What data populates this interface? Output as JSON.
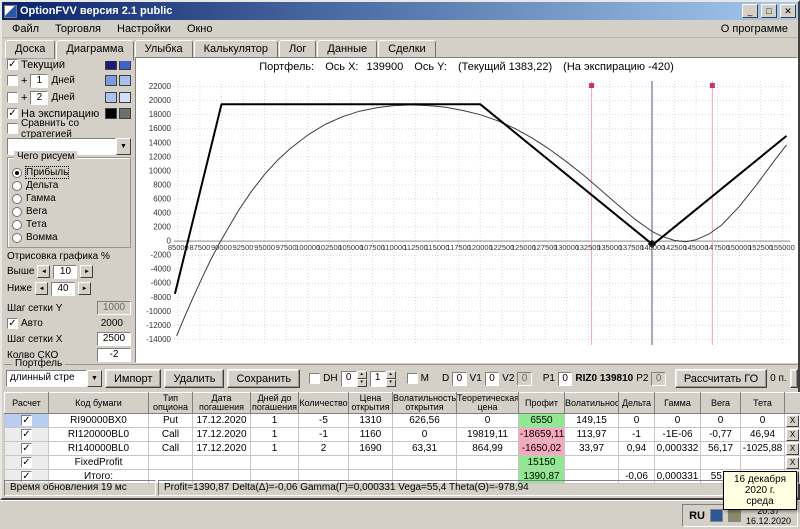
{
  "window": {
    "title": "OptionFVV версия 2.1 public",
    "controls": {
      "minimize": "_",
      "maximize": "□",
      "close": "✕"
    }
  },
  "menu": {
    "items": [
      "Файл",
      "Торговля",
      "Настройки",
      "Окно"
    ],
    "about": "О программе"
  },
  "tabs": {
    "items": [
      "Доска",
      "Диаграмма",
      "Улыбка",
      "Калькулятор",
      "Лог",
      "Данные",
      "Сделки"
    ],
    "active_index": 1
  },
  "sidebar": {
    "current": {
      "label": "Текущий",
      "colors": [
        "#1c1c74",
        "#3f63c8"
      ]
    },
    "day1": {
      "plus": "+",
      "value": "1",
      "label": "Дней",
      "colors": [
        "#7d9ce0",
        "#a8c0ec"
      ]
    },
    "day2": {
      "plus": "+",
      "value": "2",
      "label": "Дней",
      "colors": [
        "#aac2ee",
        "#d3e1f6"
      ]
    },
    "expiration": {
      "label": "На экспирацию",
      "colors": [
        "#000000",
        "#6e6e6e"
      ]
    },
    "compare": {
      "label": "Сравнить со стратегией"
    },
    "strategy_value": "",
    "draw": {
      "title": "Чего рисуем",
      "options": [
        "Прибыль",
        "Дельта",
        "Гамма",
        "Вега",
        "Тета",
        "Вомма"
      ],
      "selected_index": 0
    },
    "render_pct": {
      "label": "Отрисовка графика %",
      "above_label": "Выше",
      "above_value": "10",
      "below_label": "Ниже",
      "below_value": "40"
    },
    "grid": {
      "y_label": "Шаг сетки Y",
      "y_value": "1000",
      "auto_label": "Авто",
      "auto_value": "2000",
      "x_label": "Шаг сетки X",
      "x_value": "2500"
    },
    "sko": {
      "label": "Колво СКО",
      "value": "-2"
    }
  },
  "chart_header": {
    "portfolio": "Портфель:",
    "x_label": "Ось X:",
    "x_value": "139900",
    "y_label": "Ось Y:",
    "current": "(Текущий 1383,22)",
    "expiration": "(На экспирацию -420)"
  },
  "chart_data": {
    "type": "line",
    "title": "Портфель: Ось X: 139900 Ось Y: (Текущий 1383,22) (На экспирацию -420)",
    "xlim": [
      84500,
      155900
    ],
    "ylim": [
      -14800,
      22800
    ],
    "x_ticks": [
      85000,
      87500,
      90000,
      92500,
      95000,
      97500,
      100000,
      102500,
      105000,
      107500,
      110000,
      112500,
      115000,
      117500,
      120000,
      122500,
      125000,
      127500,
      130000,
      132500,
      135000,
      137500,
      140000,
      142500,
      145000,
      147500,
      150000,
      152500,
      155000
    ],
    "y_ticks": [
      22000,
      20000,
      18000,
      16000,
      14000,
      12000,
      10000,
      8000,
      6000,
      4000,
      2000,
      0,
      -2000,
      -4000,
      -6000,
      -8000,
      -10000,
      -12000,
      -14000
    ],
    "grid": true,
    "x_labels_at_zero": true,
    "current_x": 139900,
    "sd_lines": [
      132900,
      146900
    ],
    "sd_color": "#f0a6c0",
    "sd_marker_color": "#cc3366",
    "current_line_color": "#55607a",
    "marker": {
      "x": 139900,
      "y": -420
    },
    "series": [
      {
        "name": "Текущий",
        "color": "#3c3c3c",
        "width": 1,
        "points": [
          [
            84800,
            -13500
          ],
          [
            85800,
            -10600
          ],
          [
            86800,
            -7800
          ],
          [
            87800,
            -5100
          ],
          [
            88800,
            -2550
          ],
          [
            89800,
            -250
          ],
          [
            90800,
            1900
          ],
          [
            92000,
            4400
          ],
          [
            93500,
            7100
          ],
          [
            95000,
            9500
          ],
          [
            96500,
            11500
          ],
          [
            98000,
            13200
          ],
          [
            100000,
            15100
          ],
          [
            102000,
            16600
          ],
          [
            104000,
            17700
          ],
          [
            106000,
            18500
          ],
          [
            108000,
            19000
          ],
          [
            110000,
            19300
          ],
          [
            112000,
            19400
          ],
          [
            114000,
            19300
          ],
          [
            116000,
            19050
          ],
          [
            118000,
            18600
          ],
          [
            120000,
            18000
          ],
          [
            122000,
            17150
          ],
          [
            124000,
            16050
          ],
          [
            126000,
            14700
          ],
          [
            128000,
            13100
          ],
          [
            130000,
            11300
          ],
          [
            132000,
            9350
          ],
          [
            134000,
            7250
          ],
          [
            136000,
            5100
          ],
          [
            138000,
            3050
          ],
          [
            139900,
            1383
          ],
          [
            141000,
            700
          ],
          [
            142500,
            100
          ],
          [
            143800,
            -100
          ],
          [
            145000,
            200
          ],
          [
            146500,
            1000
          ],
          [
            148000,
            2300
          ],
          [
            150000,
            4900
          ],
          [
            152000,
            8000
          ],
          [
            154000,
            11300
          ],
          [
            155500,
            13700
          ]
        ]
      },
      {
        "name": "На экспирацию",
        "color": "#000000",
        "width": 2,
        "points": [
          [
            84600,
            -7520
          ],
          [
            90000,
            19480
          ],
          [
            120000,
            19480
          ],
          [
            140000,
            -520
          ],
          [
            155500,
            14980
          ]
        ]
      }
    ]
  },
  "toolbar": {
    "group_label": "Портфель",
    "strategy_value": "длинный стре",
    "import_label": "Импорт",
    "delete_label": "Удалить",
    "save_label": "Сохранить",
    "dh_label": "DH",
    "dh_value1": "0",
    "dh_value2": "1",
    "m_label": "М",
    "d_label": "D",
    "d_value": "0",
    "v1_label": "V1",
    "v1_value": "0",
    "v2_label": "V2",
    "v2_value": "0",
    "p1_label": "P1",
    "p1_value": "0",
    "ticker": "RIZ0 139810",
    "p2_label": "P2",
    "p2_value": "0",
    "calc_label": "Рассчитать ГО",
    "points_label": "0 п.",
    "spin_up": "▴",
    "spin_down": "▾",
    "left_arrow": "◄",
    "right_arrow": "►",
    "drop_arrow": "▼"
  },
  "table": {
    "headers": [
      "Расчет",
      "Код бумаги",
      "Тип опциона",
      "Дата погашения",
      "Дней до погашения",
      "Количество",
      "Цена открытия",
      "Волатильность открытия",
      "Теоретическая цена",
      "Профит",
      "Волатильность",
      "Дельта",
      "Гамма",
      "Вега",
      "Тета",
      ""
    ],
    "delete_glyph": "X",
    "rows": [
      {
        "checked": true,
        "selected": true,
        "profit_color": "green",
        "cells": [
          "RI90000BX0",
          "Put",
          "17.12.2020",
          "1",
          "-5",
          "1310",
          "626,56",
          "0",
          "6550",
          "149,15",
          "0",
          "0",
          "0",
          "0"
        ]
      },
      {
        "checked": true,
        "selected": false,
        "profit_color": "pink",
        "cells": [
          "RI120000BL0",
          "Call",
          "17.12.2020",
          "1",
          "-1",
          "1160",
          "0",
          "19819,11",
          "-18659,11",
          "113,97",
          "-1",
          "-1E-06",
          "-0,77",
          "46,94"
        ]
      },
      {
        "checked": true,
        "selected": false,
        "profit_color": "pink",
        "cells": [
          "RI140000BL0",
          "Call",
          "17.12.2020",
          "1",
          "2",
          "1690",
          "63,31",
          "864,99",
          "-1650,02",
          "33,97",
          "0,94",
          "0,000332",
          "56,17",
          "-1025,88"
        ]
      },
      {
        "checked": true,
        "selected": false,
        "profit_color": "green",
        "cells": [
          "FixedProfit",
          "",
          "",
          "",
          "",
          "",
          "",
          "",
          "15150",
          "",
          "",
          "",
          "",
          ""
        ]
      },
      {
        "checked": true,
        "selected": false,
        "profit_color": "green",
        "cells": [
          "Итого:",
          "",
          "",
          "",
          "",
          "",
          "",
          "",
          "1390,87",
          "",
          "-0,06",
          "0,000331",
          "55,4",
          "-978,94"
        ]
      }
    ]
  },
  "status": {
    "left": "Время обновления 19 мс",
    "right": "Profit=1390,87 Delta(Δ)=-0,06 Gamma(Γ)=0,000331 Vega=55,4 Theta(Θ)=-978,94"
  },
  "taskbar": {
    "lang": "RU",
    "time": "20:37",
    "date": "16.12.2020"
  },
  "tooltip": {
    "line1": "16 декабря 2020 г.",
    "line2": "среда"
  }
}
